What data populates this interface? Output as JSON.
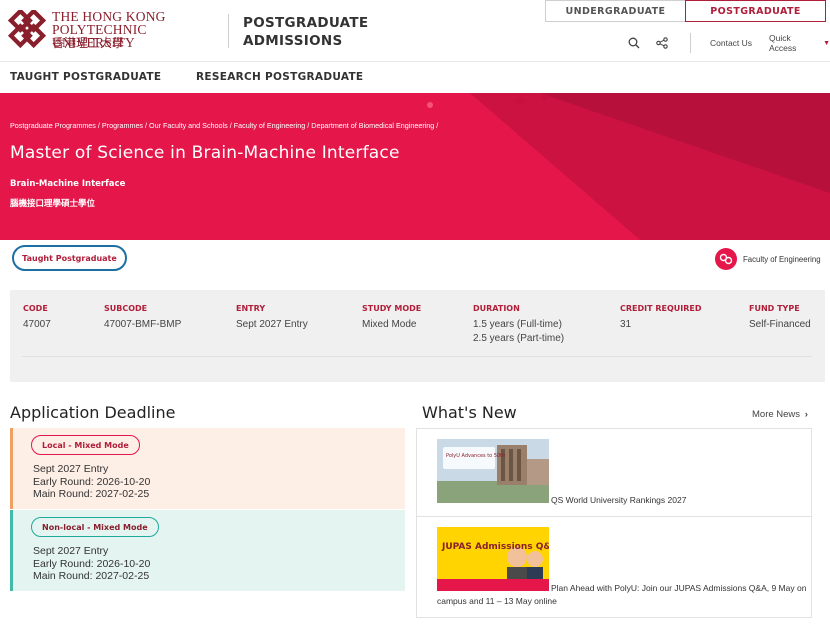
{
  "header": {
    "uni_name_en_line1": "THE HONG KONG",
    "uni_name_en_line2": "POLYTECHNIC UNIVERSITY",
    "uni_name_zh": "香港理工大學",
    "site_title_line1": "POSTGRADUATE",
    "site_title_line2": "ADMISSIONS",
    "level_tabs": [
      "UNDERGRADUATE",
      "POSTGRADUATE"
    ],
    "contact_us": "Contact Us",
    "quick_access": "Quick Access",
    "brand_color": "#8a1f2c",
    "accent_color": "#e5164a"
  },
  "nav": {
    "taught": "TAUGHT POSTGRADUATE",
    "research": "RESEARCH POSTGRADUATE"
  },
  "hero": {
    "breadcrumb": [
      "Postgraduate Programmes /",
      "Programmes /",
      "Our Faculty and Schools /",
      "Faculty of Engineering /",
      "Department of Biomedical Engineering /"
    ],
    "title": "Master of Science in Brain-Machine Interface",
    "subtitle_en": "Brain-Machine Interface",
    "subtitle_zh": "腦機接口理學碩士學位"
  },
  "tags": {
    "programme_type": "Taught Postgraduate",
    "faculty": "Faculty of Engineering"
  },
  "info": {
    "code_label": "CODE",
    "code": "47007",
    "subcode_label": "SUBCODE",
    "subcode": "47007-BMF-BMP",
    "entry_label": "ENTRY",
    "entry": "Sept 2027 Entry",
    "study_mode_label": "STUDY MODE",
    "study_mode": "Mixed Mode",
    "duration_label": "DURATION",
    "duration_full": "1.5 years (Full-time)",
    "duration_part": "2.5 years (Part-time)",
    "credit_label": "CREDIT REQUIRED",
    "credit": "31",
    "fund_label": "FUND TYPE",
    "fund": "Self-Financed"
  },
  "deadline": {
    "title": "Application Deadline",
    "local": {
      "label": "Local - Mixed Mode",
      "entry": "Sept 2027 Entry",
      "early": "Early Round: 2026-10-20",
      "main": "Main Round: 2027-02-25"
    },
    "nonlocal": {
      "label": "Non-local - Mixed Mode",
      "entry": "Sept 2027 Entry",
      "early": "Early Round: 2026-10-20",
      "main": "Main Round: 2027-02-25"
    }
  },
  "news": {
    "title": "What's New",
    "more": "More News",
    "items": [
      {
        "caption": "QS World University Rankings 2027",
        "thumb_text": "PolyU Advances to 50th"
      },
      {
        "caption": "Plan Ahead with PolyU: Join our JUPAS Admissions Q&A, 9 May on campus and 11 – 13 May online",
        "thumb_text": "JUPAS Admissions Q&A"
      }
    ]
  }
}
